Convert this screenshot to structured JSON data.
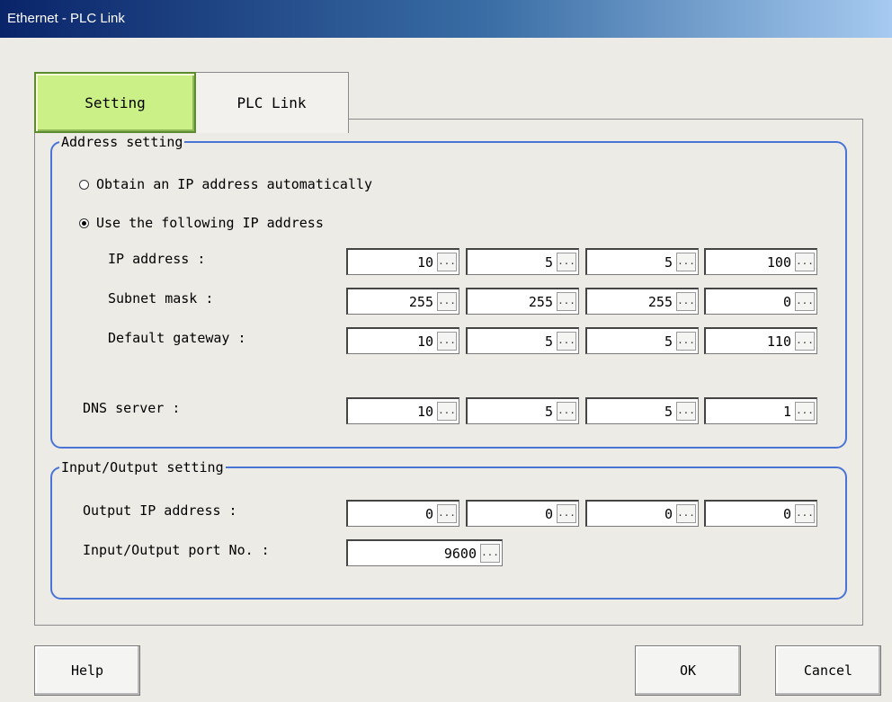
{
  "window": {
    "title": "Ethernet - PLC Link"
  },
  "tabs": [
    {
      "label": "Setting",
      "active": true
    },
    {
      "label": "PLC Link",
      "active": false
    }
  ],
  "address_setting": {
    "legend": "Address setting",
    "radio_auto": {
      "label": "Obtain an IP address automatically",
      "selected": false
    },
    "radio_manual": {
      "label": "Use the following IP address",
      "selected": true
    },
    "ip_address": {
      "label": "IP address :",
      "octets": [
        "10",
        "5",
        "5",
        "100"
      ]
    },
    "subnet_mask": {
      "label": "Subnet mask :",
      "octets": [
        "255",
        "255",
        "255",
        "0"
      ]
    },
    "default_gateway": {
      "label": "Default gateway :",
      "octets": [
        "10",
        "5",
        "5",
        "110"
      ]
    },
    "dns_server": {
      "label": "DNS server :",
      "octets": [
        "10",
        "5",
        "5",
        "1"
      ]
    }
  },
  "io_setting": {
    "legend": "Input/Output setting",
    "output_ip": {
      "label": "Output IP address :",
      "octets": [
        "0",
        "0",
        "0",
        "0"
      ]
    },
    "port": {
      "label": "Input/Output port No. :",
      "value": "9600"
    }
  },
  "ellipsis": "...",
  "buttons": {
    "help": "Help",
    "ok": "OK",
    "cancel": "Cancel"
  },
  "colors": {
    "active_tab": "#ccf088",
    "group_border": "#4a73d6",
    "title_bar": "#0a246a"
  }
}
